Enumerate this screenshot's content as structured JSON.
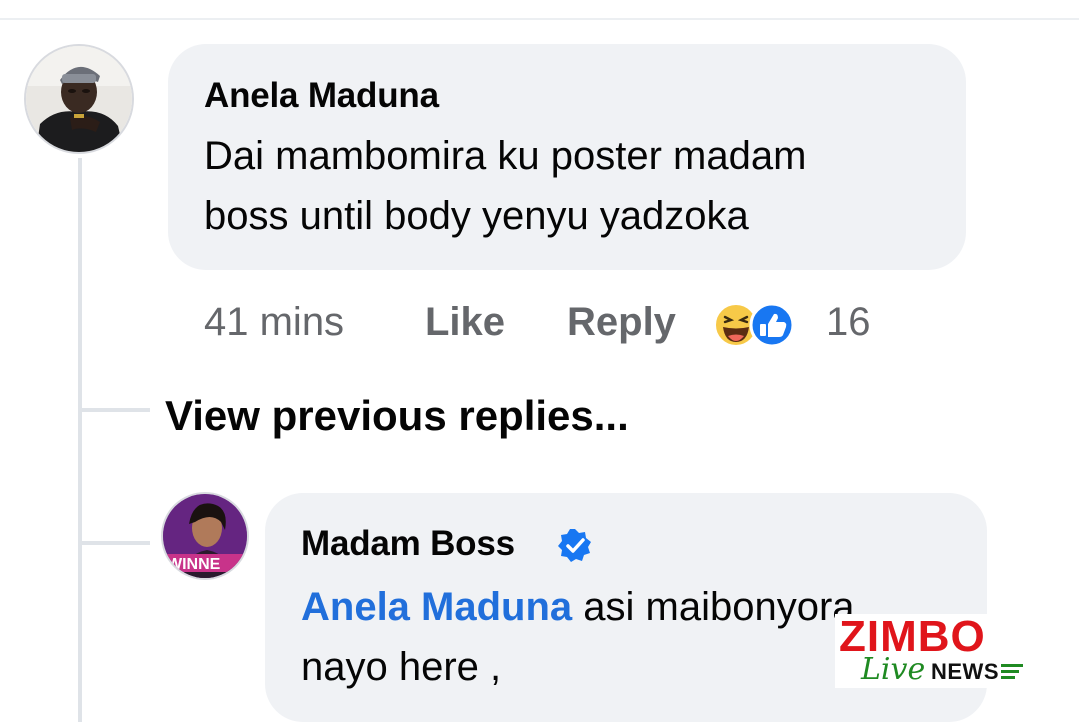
{
  "comment": {
    "author": "Anela Maduna",
    "text_line1": "Dai mambomira ku poster madam",
    "text_line2": "boss until body yenyu yadzoka",
    "time": "41 mins",
    "like_label": "Like",
    "reply_label": "Reply",
    "reactions": [
      "haha-icon",
      "like-icon"
    ],
    "reaction_count": "16"
  },
  "thread": {
    "view_previous_label": "View previous replies..."
  },
  "reply": {
    "author": "Madam Boss",
    "verified": true,
    "mention": "Anela Maduna",
    "text_line1_rest": " asi maibonyora",
    "text_line2": "nayo here ,",
    "avatar_badge_text": "WINNE"
  },
  "watermark": {
    "brand": "ZIMBO",
    "live": "Live",
    "news": "NEWS"
  },
  "colors": {
    "bubble": "#f0f2f5",
    "secondary_text": "#65676b",
    "mention": "#216fdb",
    "verified": "#1877f2"
  }
}
